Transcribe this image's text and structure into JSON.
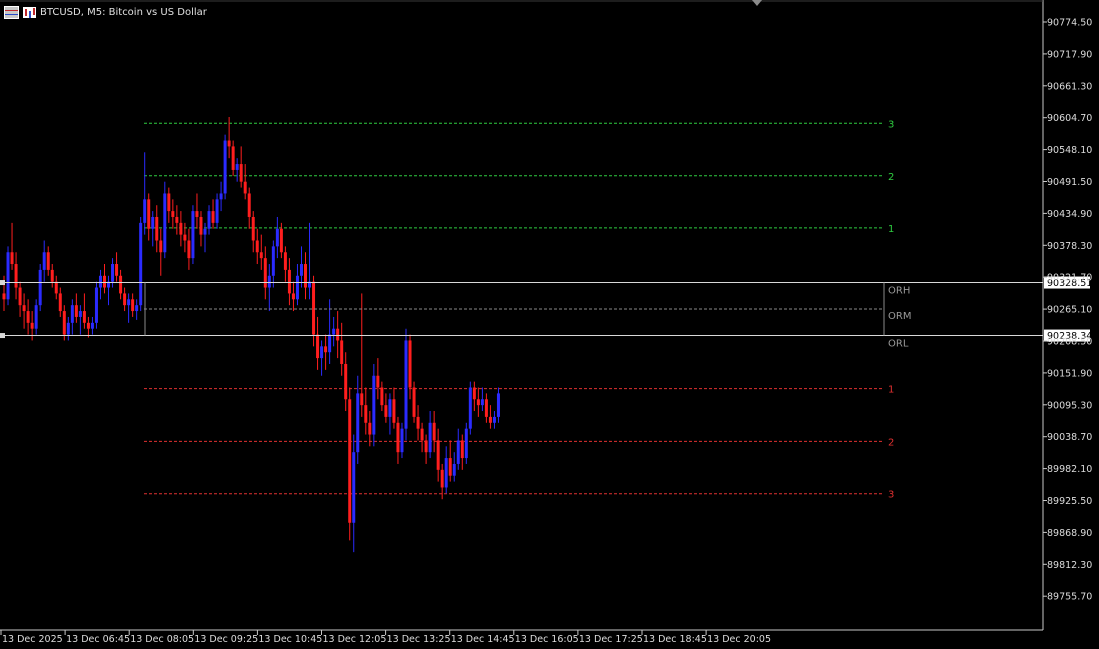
{
  "window": {
    "title": "BTCUSD, M5:  Bitcoin vs US Dollar"
  },
  "colors": {
    "background": "#000000",
    "axis": "#c8c8c8",
    "axis_text": "#dcdcdc",
    "bull": "#2b2bff",
    "bear": "#ff1e1e",
    "upper_levels": "#2ecc40",
    "lower_levels": "#e03030",
    "range_lines": "#d8d8d8",
    "range_labels": "#9a9a9a",
    "price_tag_bg": "#ffffff",
    "price_tag_text": "#000000"
  },
  "price_axis": {
    "labels": [
      "90774.50",
      "90717.90",
      "90661.30",
      "90604.70",
      "90548.10",
      "90491.50",
      "90434.90",
      "90378.30",
      "90321.70",
      "90265.10",
      "90208.50",
      "90151.90",
      "90095.30",
      "90038.70",
      "89982.10",
      "89925.50",
      "89868.90",
      "89812.30",
      "89755.70"
    ]
  },
  "time_axis": {
    "labels": [
      "13 Dec 2025",
      "13 Dec 06:45",
      "13 Dec 08:05",
      "13 Dec 09:25",
      "13 Dec 10:45",
      "13 Dec 12:05",
      "13 Dec 13:25",
      "13 Dec 14:45",
      "13 Dec 16:05",
      "13 Dec 17:25",
      "13 Dec 18:45",
      "13 Dec 20:05"
    ]
  },
  "opening_range": {
    "high": 90328.51,
    "low": 90238.34,
    "high_tag": "90328.51",
    "low_tag": "90238.34",
    "labels": [
      "ORH",
      "ORM",
      "ORL"
    ]
  },
  "levels": {
    "upper": [
      {
        "label": "1",
        "price": 90421.4
      },
      {
        "label": "2",
        "price": 90510.1
      },
      {
        "label": "3",
        "price": 90599.3
      }
    ],
    "lower": [
      {
        "label": "1",
        "price": 90148.1
      },
      {
        "label": "2",
        "price": 90058.3
      },
      {
        "label": "3",
        "price": 89969.4
      }
    ]
  },
  "chart_data": {
    "type": "candlestick",
    "symbol": "BTCUSD",
    "timeframe": "M5",
    "ylim": [
      89737.6,
      90807.3
    ],
    "candles": [
      [
        90310,
        90340,
        90280,
        90300
      ],
      [
        90300,
        90390,
        90290,
        90380
      ],
      [
        90380,
        90430,
        90350,
        90360
      ],
      [
        90360,
        90380,
        90300,
        90320
      ],
      [
        90320,
        90330,
        90270,
        90290
      ],
      [
        90290,
        90310,
        90250,
        90280
      ],
      [
        90280,
        90300,
        90240,
        90260
      ],
      [
        90260,
        90280,
        90230,
        90250
      ],
      [
        90250,
        90300,
        90240,
        90290
      ],
      [
        90290,
        90360,
        90280,
        90350
      ],
      [
        90350,
        90400,
        90330,
        90380
      ],
      [
        90380,
        90390,
        90340,
        90350
      ],
      [
        90350,
        90360,
        90320,
        90330
      ],
      [
        90330,
        90340,
        90300,
        90310
      ],
      [
        90310,
        90320,
        90270,
        90280
      ],
      [
        90280,
        90290,
        90230,
        90240
      ],
      [
        90240,
        90270,
        90230,
        90260
      ],
      [
        90260,
        90300,
        90240,
        90290
      ],
      [
        90290,
        90310,
        90260,
        90270
      ],
      [
        90270,
        90290,
        90240,
        90280
      ],
      [
        90280,
        90310,
        90250,
        90260
      ],
      [
        90260,
        90270,
        90235,
        90250
      ],
      [
        90250,
        90270,
        90240,
        90260
      ],
      [
        90260,
        90330,
        90250,
        90320
      ],
      [
        90320,
        90350,
        90300,
        90340
      ],
      [
        90340,
        90360,
        90310,
        90320
      ],
      [
        90320,
        90340,
        90290,
        90330
      ],
      [
        90330,
        90370,
        90320,
        90360
      ],
      [
        90360,
        90380,
        90330,
        90340
      ],
      [
        90340,
        90350,
        90300,
        90310
      ],
      [
        90310,
        90320,
        90280,
        90290
      ],
      [
        90290,
        90310,
        90260,
        90300
      ],
      [
        90300,
        90310,
        90270,
        90280
      ],
      [
        90280,
        90300,
        90265,
        90290
      ],
      [
        90290,
        90440,
        90280,
        90430
      ],
      [
        90430,
        90550,
        90410,
        90470
      ],
      [
        90470,
        90480,
        90400,
        90420
      ],
      [
        90420,
        90450,
        90390,
        90440
      ],
      [
        90440,
        90460,
        90380,
        90400
      ],
      [
        90400,
        90420,
        90340,
        90380
      ],
      [
        90380,
        90500,
        90370,
        90480
      ],
      [
        90480,
        90490,
        90430,
        90450
      ],
      [
        90450,
        90470,
        90420,
        90440
      ],
      [
        90440,
        90460,
        90410,
        90430
      ],
      [
        90430,
        90450,
        90390,
        90410
      ],
      [
        90410,
        90430,
        90380,
        90400
      ],
      [
        90400,
        90420,
        90350,
        90370
      ],
      [
        90370,
        90460,
        90360,
        90450
      ],
      [
        90450,
        90480,
        90420,
        90440
      ],
      [
        90440,
        90450,
        90390,
        90410
      ],
      [
        90410,
        90430,
        90380,
        90420
      ],
      [
        90420,
        90460,
        90410,
        90450
      ],
      [
        90450,
        90470,
        90420,
        90430
      ],
      [
        90430,
        90480,
        90420,
        90470
      ],
      [
        90470,
        90500,
        90450,
        90480
      ],
      [
        90480,
        90580,
        90470,
        90570
      ],
      [
        90570,
        90610,
        90540,
        90560
      ],
      [
        90560,
        90570,
        90510,
        90520
      ],
      [
        90520,
        90540,
        90500,
        90530
      ],
      [
        90530,
        90560,
        90490,
        90500
      ],
      [
        90500,
        90530,
        90470,
        90480
      ],
      [
        90480,
        90490,
        90420,
        90440
      ],
      [
        90440,
        90450,
        90380,
        90400
      ],
      [
        90400,
        90420,
        90360,
        90380
      ],
      [
        90380,
        90410,
        90350,
        90370
      ],
      [
        90370,
        90390,
        90300,
        90320
      ],
      [
        90320,
        90360,
        90280,
        90340
      ],
      [
        90340,
        90400,
        90320,
        90390
      ],
      [
        90390,
        90440,
        90370,
        90420
      ],
      [
        90420,
        90430,
        90370,
        90380
      ],
      [
        90380,
        90390,
        90330,
        90350
      ],
      [
        90350,
        90370,
        90290,
        90310
      ],
      [
        90310,
        90330,
        90280,
        90300
      ],
      [
        90300,
        90360,
        90290,
        90340
      ],
      [
        90340,
        90390,
        90320,
        90360
      ],
      [
        90360,
        90380,
        90300,
        90320
      ],
      [
        90320,
        90430,
        90300,
        90330
      ],
      [
        90330,
        90340,
        90220,
        90240
      ],
      [
        90240,
        90270,
        90180,
        90200
      ],
      [
        90200,
        90230,
        90170,
        90220
      ],
      [
        90220,
        90240,
        90180,
        90210
      ],
      [
        90210,
        90300,
        90190,
        90240
      ],
      [
        90240,
        90270,
        90220,
        90250
      ],
      [
        90250,
        90280,
        90200,
        90230
      ],
      [
        90230,
        90260,
        90170,
        90190
      ],
      [
        90190,
        90210,
        90110,
        90130
      ],
      [
        90130,
        90150,
        89890,
        89920
      ],
      [
        89920,
        90070,
        89870,
        90040
      ],
      [
        90040,
        90170,
        90020,
        90140
      ],
      [
        90140,
        90310,
        90100,
        90120
      ],
      [
        90120,
        90150,
        90070,
        90090
      ],
      [
        90090,
        90110,
        90050,
        90070
      ],
      [
        90070,
        90190,
        90050,
        90170
      ],
      [
        90170,
        90200,
        90130,
        90150
      ],
      [
        90150,
        90160,
        90110,
        90120
      ],
      [
        90120,
        90140,
        90090,
        90100
      ],
      [
        90100,
        90140,
        90070,
        90130
      ],
      [
        90130,
        90150,
        90080,
        90090
      ],
      [
        90090,
        90100,
        90020,
        90040
      ],
      [
        90040,
        90090,
        90030,
        90080
      ],
      [
        90080,
        90250,
        90060,
        90230
      ],
      [
        90230,
        90240,
        90130,
        90150
      ],
      [
        90150,
        90160,
        90090,
        90100
      ],
      [
        90100,
        90120,
        90060,
        90080
      ],
      [
        90080,
        90090,
        90040,
        90060
      ],
      [
        90060,
        90070,
        90020,
        90040
      ],
      [
        90040,
        90110,
        90030,
        90090
      ],
      [
        90090,
        90110,
        90040,
        90060
      ],
      [
        90060,
        90080,
        89990,
        90010
      ],
      [
        90010,
        90020,
        89960,
        89980
      ],
      [
        89980,
        90050,
        89970,
        90030
      ],
      [
        90030,
        90060,
        89990,
        90000
      ],
      [
        90000,
        90040,
        89990,
        90020
      ],
      [
        90020,
        90080,
        90010,
        90060
      ],
      [
        90060,
        90070,
        90010,
        90030
      ],
      [
        90030,
        90090,
        90020,
        90080
      ],
      [
        90080,
        90160,
        90070,
        90150
      ],
      [
        90150,
        90160,
        90110,
        90130
      ],
      [
        90130,
        90150,
        90100,
        90120
      ],
      [
        90120,
        90150,
        90110,
        90130
      ],
      [
        90130,
        90140,
        90090,
        90100
      ],
      [
        90100,
        90120,
        90080,
        90090
      ],
      [
        90090,
        90110,
        90080,
        90100
      ],
      [
        90100,
        90150,
        90090,
        90140
      ]
    ]
  }
}
